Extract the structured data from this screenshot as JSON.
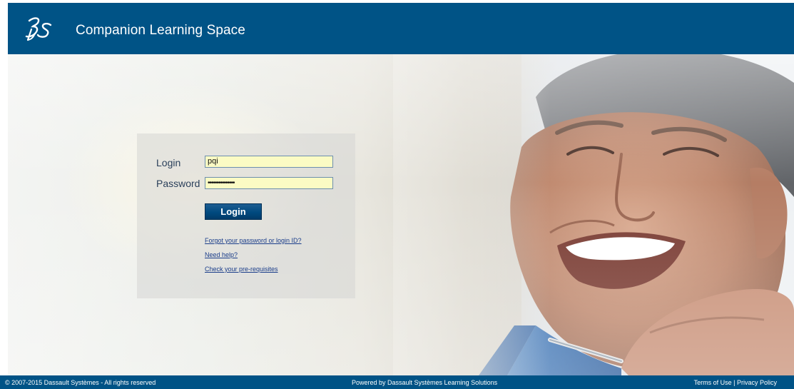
{
  "header": {
    "brand_logo": "3ds-logo-icon",
    "title": "Companion Learning Space"
  },
  "login_form": {
    "login_label": "Login",
    "login_value": "pqi",
    "password_label": "Password",
    "password_value": "•••••••••••••••",
    "submit_label": "Login",
    "links": {
      "forgot": "Forgot your password or login ID?",
      "help": "Need help?",
      "prerequisites": "Check your pre-requisites"
    }
  },
  "footer": {
    "copyright": "© 2007-2015 Dassault Systèmes - All rights reserved",
    "powered_by": "Powered by Dassault Systèmes Learning Solutions",
    "terms": "Terms of Use",
    "separator": "|",
    "privacy": "Privacy Policy"
  },
  "colors": {
    "brand_blue": "#005386",
    "input_fill": "#fbfbc4",
    "link_blue": "#1a3d8a"
  }
}
